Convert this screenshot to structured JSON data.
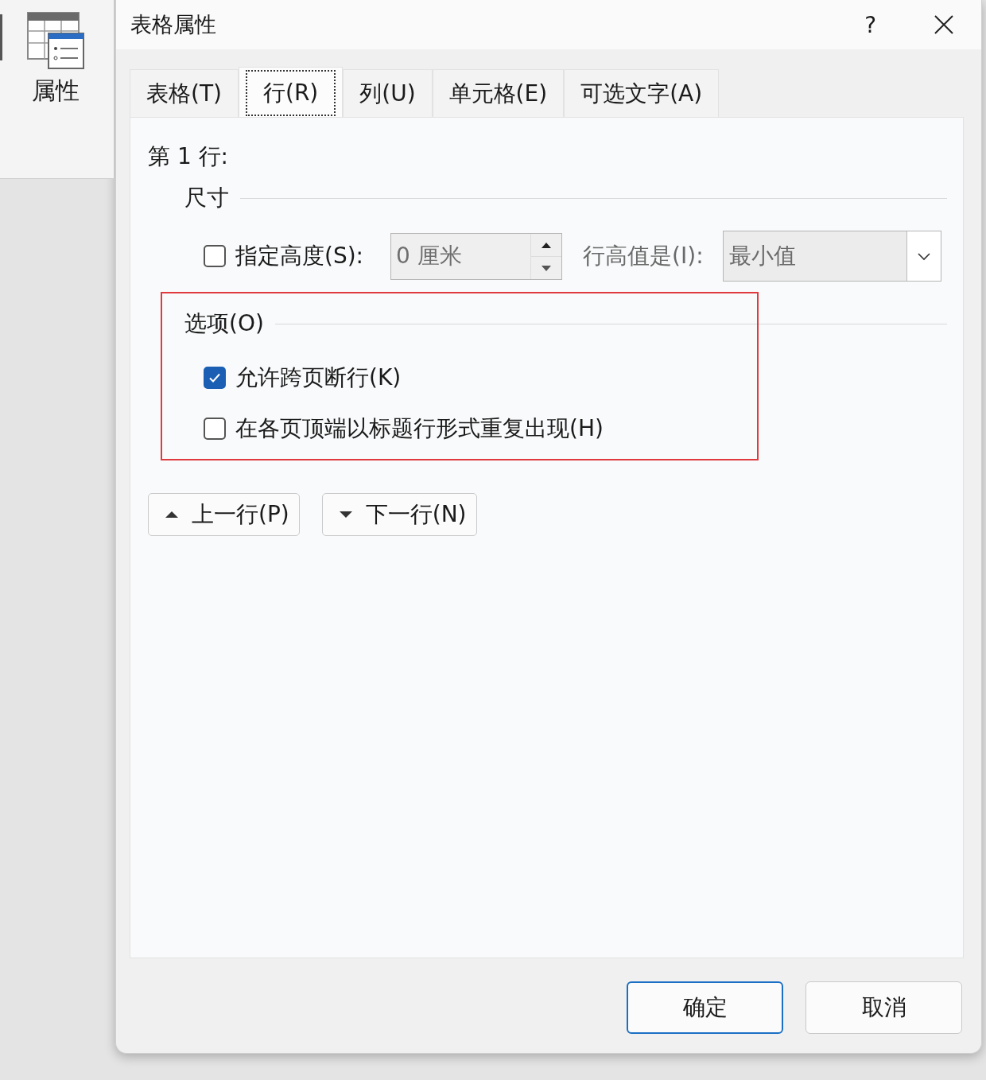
{
  "ribbon": {
    "button": {
      "label": "属性"
    }
  },
  "dialog": {
    "title": "表格属性",
    "help": "?",
    "tabs": [
      {
        "label": "表格(T)",
        "selected": false
      },
      {
        "label": "行(R)",
        "selected": true
      },
      {
        "label": "列(U)",
        "selected": false
      },
      {
        "label": "单元格(E)",
        "selected": false
      },
      {
        "label": "可选文字(A)",
        "selected": false
      }
    ],
    "row_heading": "第 1 行:",
    "size_section": {
      "title": "尺寸",
      "specify_height": {
        "label": "指定高度(S):",
        "checked": false
      },
      "height_field": {
        "value": "0 厘米"
      },
      "height_rule_label": "行高值是(I):",
      "height_rule": {
        "value": "最小值"
      }
    },
    "options_section": {
      "title": "选项(O)",
      "highlighted": true,
      "items": [
        {
          "label": "允许跨页断行(K)",
          "checked": true
        },
        {
          "label": "在各页顶端以标题行形式重复出现(H)",
          "checked": false
        }
      ]
    },
    "nav_buttons": [
      {
        "label": "上一行(P)",
        "kind": "up"
      },
      {
        "label": "下一行(N)",
        "kind": "down"
      }
    ],
    "buttons": [
      {
        "label": "确定",
        "default": true
      },
      {
        "label": "取消",
        "default": false
      }
    ]
  }
}
